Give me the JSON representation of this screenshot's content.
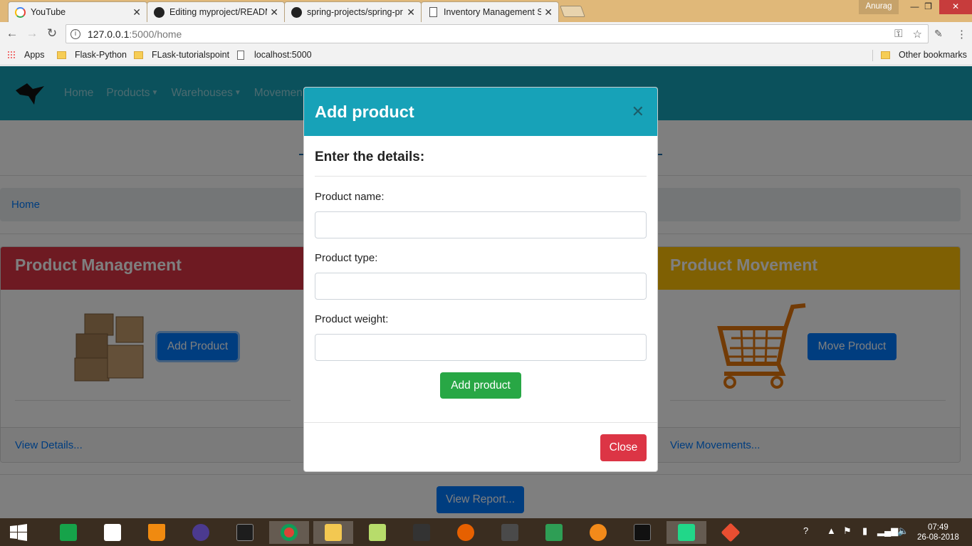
{
  "browser": {
    "tabs": [
      {
        "title": "YouTube",
        "icon": "google-icon"
      },
      {
        "title": "Editing myproject/READM",
        "icon": "github-icon"
      },
      {
        "title": "spring-projects/spring-pr",
        "icon": "github-icon"
      },
      {
        "title": "Inventory Management S",
        "icon": "document-icon",
        "active": true
      }
    ],
    "user": "Anurag",
    "url_host": "127.0.0.1",
    "url_path": ":5000/home",
    "bookmarks": [
      "Apps",
      "Flask-Python",
      "FLask-tutorialspoint",
      "localhost:5000"
    ],
    "other_bookmarks": "Other bookmarks"
  },
  "navbar": {
    "links": [
      {
        "label": "Home",
        "dropdown": false
      },
      {
        "label": "Products",
        "dropdown": true
      },
      {
        "label": "Warehouses",
        "dropdown": true
      },
      {
        "label": "Movemen",
        "dropdown": false
      }
    ],
    "color": "#17a2b8"
  },
  "breadcrumb": {
    "home": "Home"
  },
  "cards": {
    "product_management": {
      "title": "Product Management",
      "button": "Add Product",
      "footer": "View Details...",
      "color": "#dc3545"
    },
    "product_movement": {
      "title": "Product Movement",
      "button": "Move Product",
      "footer": "View Movements...",
      "color": "#ffc107"
    }
  },
  "report_button": "View Report...",
  "modal": {
    "title": "Add product",
    "subtitle": "Enter the details:",
    "fields": [
      {
        "label": "Product name:",
        "value": ""
      },
      {
        "label": "Product type:",
        "value": ""
      },
      {
        "label": "Product weight:",
        "value": ""
      }
    ],
    "submit": "Add product",
    "close": "Close"
  },
  "taskbar": {
    "time": "07:49",
    "date": "26-08-2018"
  }
}
